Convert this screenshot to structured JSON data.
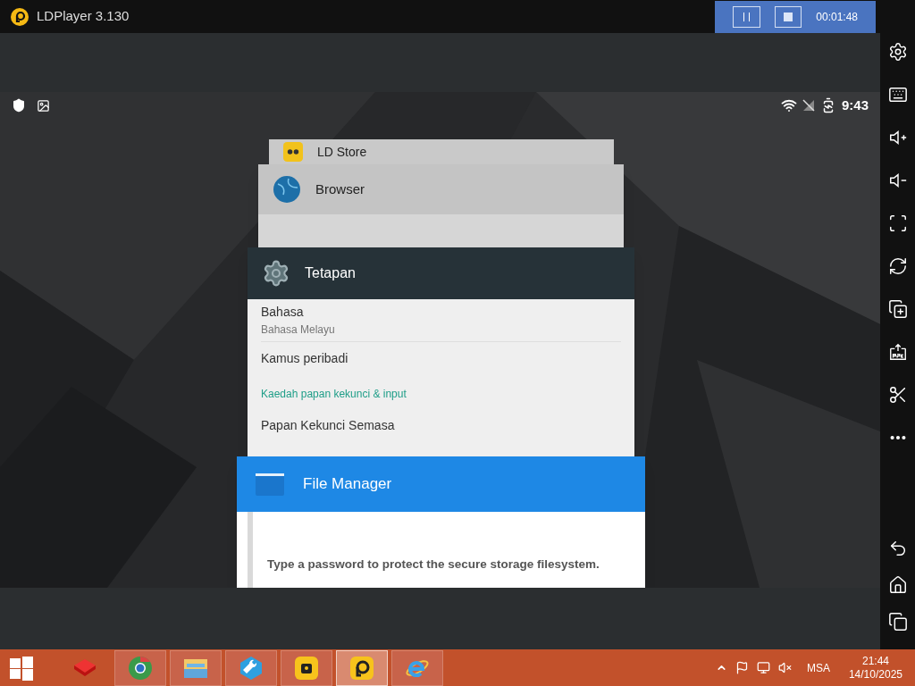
{
  "title_bar": {
    "title": "LDPlayer 3.130",
    "recorder": {
      "time": "00:01:48"
    }
  },
  "status_bar": {
    "time": "9:43"
  },
  "recents": [
    {
      "kind": "store",
      "title": "LD Store"
    },
    {
      "kind": "browser",
      "title": "Browser"
    },
    {
      "kind": "settings",
      "title": "Tetapan",
      "rows": [
        {
          "kind": "item",
          "title": "Bahasa",
          "subtitle": "Bahasa Melayu"
        },
        {
          "kind": "item",
          "title": "Kamus peribadi"
        },
        {
          "kind": "header",
          "title": "Kaedah papan kekunci & input"
        },
        {
          "kind": "item",
          "title": "Papan Kekunci Semasa"
        }
      ]
    },
    {
      "kind": "files",
      "title": "File Manager",
      "message": "Type a password to protect the secure storage filesystem."
    }
  ],
  "sidebar": [
    {
      "kind": "settings"
    },
    {
      "kind": "keyboard"
    },
    {
      "kind": "volume-up"
    },
    {
      "kind": "volume-down"
    },
    {
      "kind": "fullscreen"
    },
    {
      "kind": "rotate"
    },
    {
      "kind": "multi"
    },
    {
      "kind": "apk"
    },
    {
      "kind": "scissors"
    },
    {
      "kind": "more"
    }
  ],
  "nav": [
    {
      "kind": "back"
    },
    {
      "kind": "home"
    },
    {
      "kind": "recents"
    }
  ],
  "taskbar": {
    "apps": [
      {
        "kind": "toolbox",
        "active": false
      },
      {
        "kind": "chrome",
        "active": false
      },
      {
        "kind": "folder",
        "active": false
      },
      {
        "kind": "wrench",
        "active": false
      },
      {
        "kind": "ldstore",
        "active": false
      },
      {
        "kind": "ldplayer",
        "active": true
      },
      {
        "kind": "ie",
        "active": false
      }
    ],
    "language": "MSA",
    "time": "21:44",
    "date": "14/10/2025"
  }
}
